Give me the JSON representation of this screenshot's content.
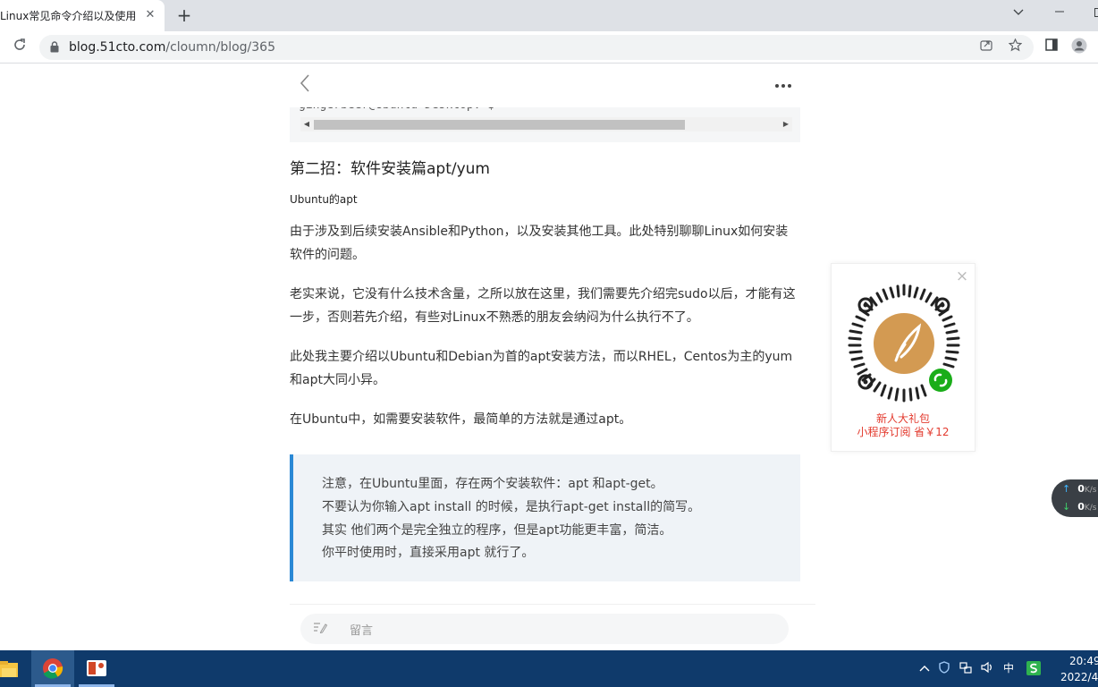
{
  "browser": {
    "tab_title": "Linux常见命令介绍以及使用",
    "tab_close_glyph": "✕",
    "new_tab_glyph": "+",
    "url_host": "blog.51cto.com",
    "url_path": "/cloumn/blog/365",
    "window_controls": [
      "chevron-down",
      "minimize",
      "maximize",
      "close"
    ]
  },
  "article": {
    "code_fragment": "gingerbeer@Ubuntu-Desktop:~$",
    "section_title": "第二招：软件安装篇apt/yum",
    "subheading": "Ubuntu的apt",
    "paragraphs": [
      "由于涉及到后续安装Ansible和Python，以及安装其他工具。此处特别聊聊Linux如何安装软件的问题。",
      "老实来说，它没有什么技术含量，之所以放在这里，我们需要先介绍完sudo以后，才能有这一步，否则若先介绍，有些对Linux不熟悉的朋友会纳闷为什么执行不了。",
      "此处我主要介绍以Ubuntu和Debian为首的apt安装方法，而以RHEL，Centos为主的yum和apt大同小异。",
      "在Ubuntu中，如需要安装软件，最简单的方法就是通过apt。"
    ],
    "quote_lines": [
      "注意，在Ubuntu里面，存在两个安装软件：apt 和apt-get。",
      "不要认为你输入apt install 的时候，是执行apt-get install的简写。",
      "其实 他们两个是完全独立的程序，但是apt功能更丰富，简洁。",
      "你平时使用时，直接采用apt 就行了。"
    ],
    "comment_placeholder": "留言"
  },
  "promo": {
    "line1": "新人大礼包",
    "line2": "小程序订阅 省￥12"
  },
  "netspeed": {
    "up_value": "0",
    "up_unit": "K/s",
    "down_value": "0",
    "down_unit": "K/s"
  },
  "taskbar": {
    "ime": "中",
    "time": "20:49",
    "date": "2022/4/"
  },
  "colors": {
    "quote_border": "#2a88d5",
    "promo_text": "#e33a2e",
    "taskbar": "#0f3a6b"
  }
}
